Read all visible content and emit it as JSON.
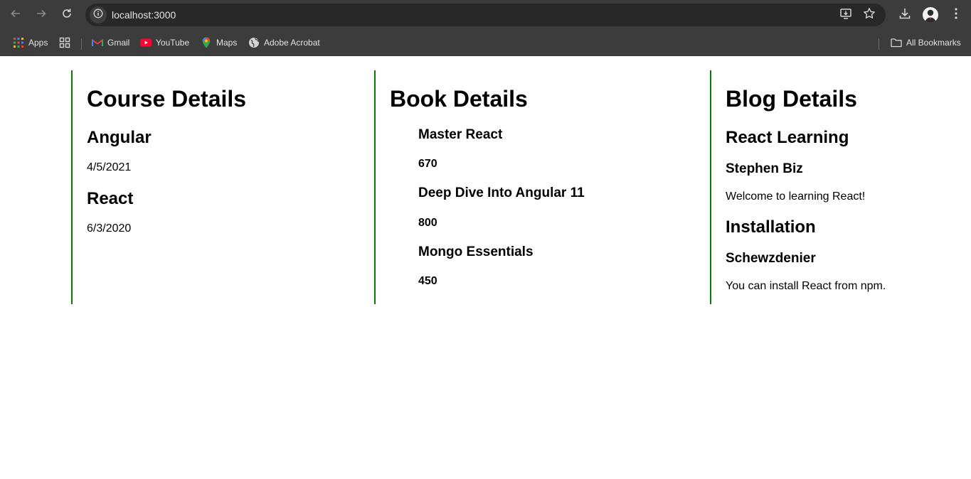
{
  "browser": {
    "url": "localhost:3000",
    "bookmarks": [
      {
        "label": "Apps",
        "icon": "apps-grid-icon"
      },
      {
        "label": "Gmail",
        "icon": "gmail-icon"
      },
      {
        "label": "YouTube",
        "icon": "youtube-icon"
      },
      {
        "label": "Maps",
        "icon": "maps-icon"
      },
      {
        "label": "Adobe Acrobat",
        "icon": "globe-icon"
      }
    ],
    "all_bookmarks_label": "All Bookmarks"
  },
  "colors": {
    "column_border": "#008000",
    "chrome_bg": "#3c3c3c",
    "omnibox_bg": "#282828"
  },
  "course": {
    "title": "Course Details",
    "items": [
      {
        "name": "Angular",
        "date": "4/5/2021"
      },
      {
        "name": "React",
        "date": "6/3/2020"
      }
    ]
  },
  "book": {
    "title": "Book Details",
    "items": [
      {
        "name": "Master React",
        "price": "670"
      },
      {
        "name": "Deep Dive Into Angular 11",
        "price": "800"
      },
      {
        "name": "Mongo Essentials",
        "price": "450"
      }
    ]
  },
  "blog": {
    "title": "Blog Details",
    "items": [
      {
        "title": "React Learning",
        "author": "Stephen Biz",
        "content": "Welcome to learning React!"
      },
      {
        "title": "Installation",
        "author": "Schewzdenier",
        "content": "You can install React from npm."
      }
    ]
  }
}
